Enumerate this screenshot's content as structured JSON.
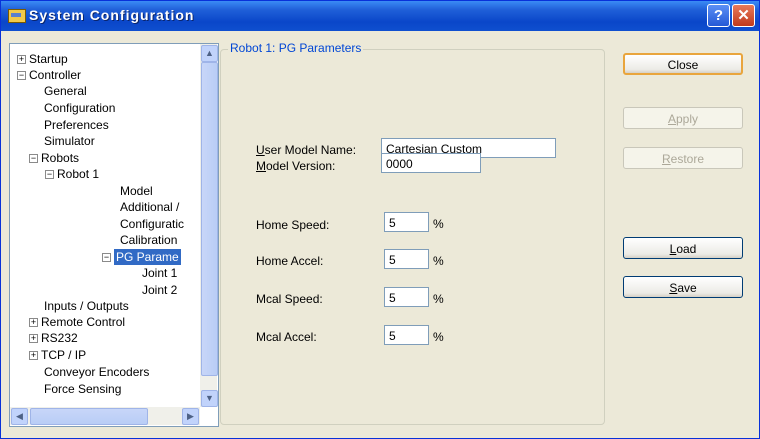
{
  "window": {
    "title": "System Configuration"
  },
  "tree": {
    "items": [
      {
        "label": "Startup"
      },
      {
        "label": "Controller"
      },
      {
        "label": "General"
      },
      {
        "label": "Configuration"
      },
      {
        "label": "Preferences"
      },
      {
        "label": "Simulator"
      },
      {
        "label": "Robots"
      },
      {
        "label": "Robot 1"
      },
      {
        "label": "Model"
      },
      {
        "label": "Additional /"
      },
      {
        "label": "Configuratic"
      },
      {
        "label": "Calibration"
      },
      {
        "label": "PG Parame"
      },
      {
        "label": "Joint 1"
      },
      {
        "label": "Joint 2"
      },
      {
        "label": "Inputs / Outputs"
      },
      {
        "label": "Remote Control"
      },
      {
        "label": "RS232"
      },
      {
        "label": "TCP / IP"
      },
      {
        "label": "Conveyor Encoders"
      },
      {
        "label": "Force Sensing"
      }
    ],
    "selected": "PG Parame"
  },
  "panel": {
    "group_title": "Robot 1: PG Parameters",
    "user_model_name_label_key": "U",
    "user_model_name_label_rest": "ser Model Name:",
    "user_model_name_value": "Cartesian Custom",
    "model_version_label_key": "M",
    "model_version_label_rest": "odel Version:",
    "model_version_value": "0000",
    "home_speed_label": "Home Speed:",
    "home_speed_value": "5",
    "home_accel_label": "Home Accel:",
    "home_accel_value": "5",
    "mcal_speed_label": "Mcal Speed:",
    "mcal_speed_value": "5",
    "mcal_accel_label": "Mcal Accel:",
    "mcal_accel_value": "5",
    "percent": "%"
  },
  "buttons": {
    "close": "Close",
    "apply_key": "A",
    "apply_rest": "pply",
    "restore_key": "R",
    "restore_rest": "estore",
    "load_key": "L",
    "load_rest": "oad",
    "save_key": "S",
    "save_rest": "ave"
  }
}
